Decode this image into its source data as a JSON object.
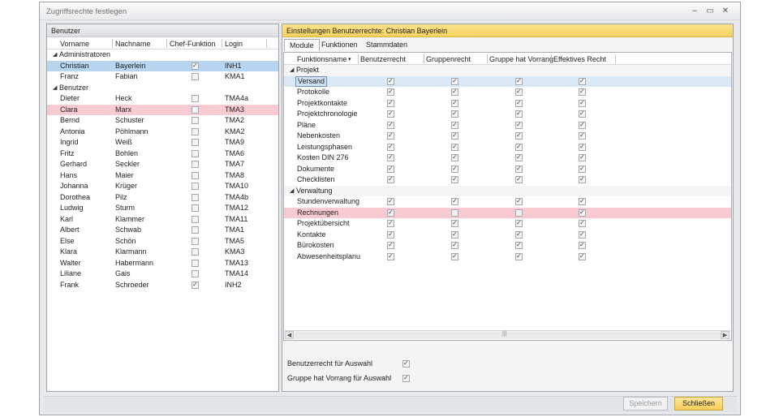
{
  "window": {
    "title": "Zugriffsrechte festlegen",
    "buttons": {
      "minimize": "‒",
      "maximize": "▭",
      "close": "✕"
    }
  },
  "users_panel": {
    "title": "Benutzer",
    "columns": [
      "Vorname",
      "Nachname",
      "Chef-Funktion",
      "Login"
    ],
    "groups": [
      {
        "name": "Administratoren",
        "rows": [
          {
            "vorname": "Christian",
            "nachname": "Bayerlein",
            "chef": true,
            "login": "INH1",
            "state": "selected"
          },
          {
            "vorname": "Franz",
            "nachname": "Fabian",
            "chef": false,
            "login": "KMA1",
            "state": ""
          }
        ]
      },
      {
        "name": "Benutzer",
        "rows": [
          {
            "vorname": "Dieter",
            "nachname": "Heck",
            "chef": false,
            "login": "TMA4a",
            "state": ""
          },
          {
            "vorname": "Clara",
            "nachname": "Marx",
            "chef": false,
            "login": "TMA3",
            "state": "highlight"
          },
          {
            "vorname": "Bernd",
            "nachname": "Schuster",
            "chef": false,
            "login": "TMA2",
            "state": ""
          },
          {
            "vorname": "Antonia",
            "nachname": "Pöhlmann",
            "chef": false,
            "login": "KMA2",
            "state": ""
          },
          {
            "vorname": "Ingrid",
            "nachname": "Weiß",
            "chef": false,
            "login": "TMA9",
            "state": ""
          },
          {
            "vorname": "Fritz",
            "nachname": "Bohlen",
            "chef": false,
            "login": "TMA6",
            "state": ""
          },
          {
            "vorname": "Gerhard",
            "nachname": "Seckler",
            "chef": false,
            "login": "TMA7",
            "state": ""
          },
          {
            "vorname": "Hans",
            "nachname": "Maier",
            "chef": false,
            "login": "TMA8",
            "state": ""
          },
          {
            "vorname": "Johanna",
            "nachname": "Krüger",
            "chef": false,
            "login": "TMA10",
            "state": ""
          },
          {
            "vorname": "Dorothea",
            "nachname": "Pilz",
            "chef": false,
            "login": "TMA4b",
            "state": ""
          },
          {
            "vorname": "Ludwig",
            "nachname": "Sturm",
            "chef": false,
            "login": "TMA12",
            "state": ""
          },
          {
            "vorname": "Karl",
            "nachname": "Klammer",
            "chef": false,
            "login": "TMA11",
            "state": ""
          },
          {
            "vorname": "Albert",
            "nachname": "Schwab",
            "chef": false,
            "login": "TMA1",
            "state": ""
          },
          {
            "vorname": "Else",
            "nachname": "Schön",
            "chef": false,
            "login": "TMA5",
            "state": ""
          },
          {
            "vorname": "Klara",
            "nachname": "Klarmann",
            "chef": false,
            "login": "KMA3",
            "state": ""
          },
          {
            "vorname": "Walter",
            "nachname": "Habermann",
            "chef": false,
            "login": "TMA13",
            "state": ""
          },
          {
            "vorname": "Liliane",
            "nachname": "Gais",
            "chef": false,
            "login": "TMA14",
            "state": ""
          },
          {
            "vorname": "Frank",
            "nachname": "Schroeder",
            "chef": true,
            "login": "INH2",
            "state": ""
          }
        ]
      }
    ]
  },
  "rights_panel": {
    "title": "Einstellungen Benutzerrechte: Christian Bayerlein",
    "tabs": [
      "Module",
      "Funktionen",
      "Stammdaten"
    ],
    "active_tab": "Module",
    "columns": [
      "Funktionsname",
      "Benutzerrecht",
      "Gruppenrecht",
      "Gruppe hat Vorrang",
      "Effektives Recht"
    ],
    "sort_indicator": "▾",
    "groups": [
      {
        "name": "Projekt",
        "rows": [
          {
            "name": "Versand",
            "values": [
              true,
              true,
              true,
              true
            ],
            "state": "selected"
          },
          {
            "name": "Protokolle",
            "values": [
              true,
              true,
              true,
              true
            ],
            "state": ""
          },
          {
            "name": "Projektkontakte",
            "values": [
              true,
              true,
              true,
              true
            ],
            "state": ""
          },
          {
            "name": "Projektchronologie",
            "values": [
              true,
              true,
              true,
              true
            ],
            "state": ""
          },
          {
            "name": "Pläne",
            "values": [
              true,
              true,
              true,
              true
            ],
            "state": ""
          },
          {
            "name": "Nebenkosten",
            "values": [
              true,
              true,
              true,
              true
            ],
            "state": ""
          },
          {
            "name": "Leistungsphasen",
            "values": [
              true,
              true,
              true,
              true
            ],
            "state": ""
          },
          {
            "name": "Kosten DIN 276",
            "values": [
              true,
              true,
              true,
              true
            ],
            "state": ""
          },
          {
            "name": "Dokumente",
            "values": [
              true,
              true,
              true,
              true
            ],
            "state": ""
          },
          {
            "name": "Checklisten",
            "values": [
              true,
              true,
              true,
              true
            ],
            "state": ""
          }
        ]
      },
      {
        "name": "Verwaltung",
        "rows": [
          {
            "name": "Stundenverwaltung",
            "values": [
              true,
              true,
              true,
              true
            ],
            "state": ""
          },
          {
            "name": "Rechnungen",
            "values": [
              true,
              false,
              false,
              true
            ],
            "state": "highlight"
          },
          {
            "name": "Projektübersicht",
            "values": [
              true,
              true,
              true,
              true
            ],
            "state": ""
          },
          {
            "name": "Kontakte",
            "values": [
              true,
              true,
              true,
              true
            ],
            "state": ""
          },
          {
            "name": "Bürokosten",
            "values": [
              true,
              true,
              true,
              true
            ],
            "state": ""
          },
          {
            "name": "Abwesenheitsplanu",
            "values": [
              true,
              true,
              true,
              true
            ],
            "state": ""
          }
        ]
      }
    ],
    "scroll_left": "◀",
    "scroll_right": "▶",
    "scroll_grip": "|||",
    "options": [
      {
        "label": "Benutzerrecht für Auswahl",
        "checked": true
      },
      {
        "label": "Gruppe hat Vorrang für Auswahl",
        "checked": true
      }
    ]
  },
  "footer": {
    "save_label": "Speichern",
    "close_label": "Schließen"
  },
  "icons": {
    "expand": "◢"
  }
}
